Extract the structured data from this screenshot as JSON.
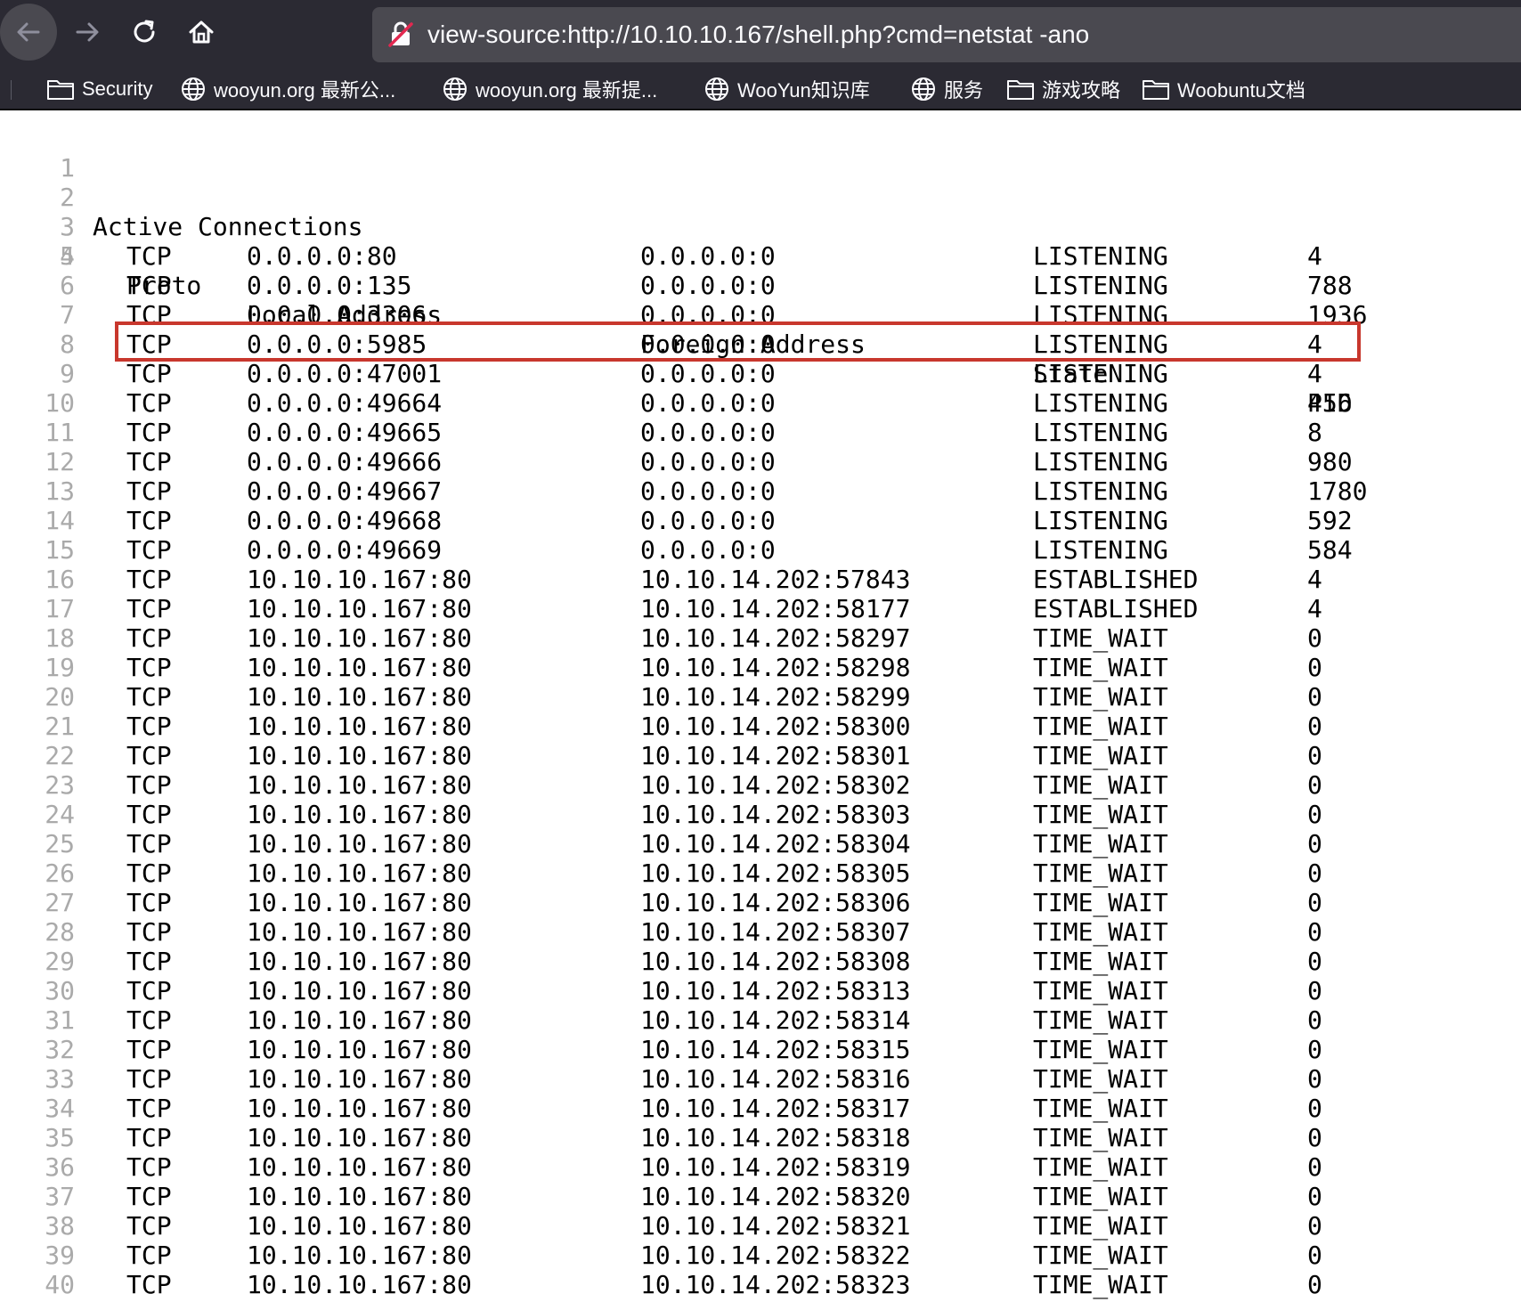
{
  "browser": {
    "url": "view-source:http://10.10.10.167/shell.php?cmd=netstat -ano",
    "colors": {
      "chrome_bg": "#2b2a33",
      "urlbar_bg": "#4a4950",
      "highlight": "#c8372d"
    },
    "bookmarks": [
      {
        "icon": "folder-icon",
        "label": "Security"
      },
      {
        "icon": "globe-icon",
        "label": "wooyun.org 最新公..."
      },
      {
        "icon": "globe-icon",
        "label": "wooyun.org 最新提..."
      },
      {
        "icon": "globe-icon",
        "label": "WooYun知识库"
      },
      {
        "icon": "globe-icon",
        "label": "服务"
      },
      {
        "icon": "folder-icon",
        "label": "游戏攻略"
      },
      {
        "icon": "folder-icon",
        "label": "Woobuntu文档"
      }
    ]
  },
  "source": {
    "title": "Active Connections",
    "headers": {
      "proto": "Proto",
      "local": "Local Address",
      "foreign": "Foreign Address",
      "state": "State",
      "pid": "PID"
    },
    "line_numbers": [
      "1",
      "2",
      "3",
      "4",
      "5",
      "6",
      "7",
      "8",
      "9",
      "10",
      "11",
      "12",
      "13",
      "14",
      "15",
      "16",
      "17",
      "18",
      "19",
      "20",
      "21",
      "22",
      "23",
      "24",
      "25",
      "26",
      "27",
      "28",
      "29",
      "30",
      "31",
      "32",
      "33",
      "34",
      "35",
      "36",
      "37",
      "38",
      "39",
      "40"
    ],
    "rows": [
      {
        "proto": "TCP",
        "local": "0.0.0.0:80",
        "foreign": "0.0.0.0:0",
        "state": "LISTENING",
        "pid": "4"
      },
      {
        "proto": "TCP",
        "local": "0.0.0.0:135",
        "foreign": "0.0.0.0:0",
        "state": "LISTENING",
        "pid": "788"
      },
      {
        "proto": "TCP",
        "local": "0.0.0.0:3306",
        "foreign": "0.0.0.0:0",
        "state": "LISTENING",
        "pid": "1936"
      },
      {
        "proto": "TCP",
        "local": "0.0.0.0:5985",
        "foreign": "0.0.0.0:0",
        "state": "LISTENING",
        "pid": "4",
        "highlighted": true
      },
      {
        "proto": "TCP",
        "local": "0.0.0.0:47001",
        "foreign": "0.0.0.0:0",
        "state": "LISTENING",
        "pid": "4"
      },
      {
        "proto": "TCP",
        "local": "0.0.0.0:49664",
        "foreign": "0.0.0.0:0",
        "state": "LISTENING",
        "pid": "456"
      },
      {
        "proto": "TCP",
        "local": "0.0.0.0:49665",
        "foreign": "0.0.0.0:0",
        "state": "LISTENING",
        "pid": "8"
      },
      {
        "proto": "TCP",
        "local": "0.0.0.0:49666",
        "foreign": "0.0.0.0:0",
        "state": "LISTENING",
        "pid": "980"
      },
      {
        "proto": "TCP",
        "local": "0.0.0.0:49667",
        "foreign": "0.0.0.0:0",
        "state": "LISTENING",
        "pid": "1780"
      },
      {
        "proto": "TCP",
        "local": "0.0.0.0:49668",
        "foreign": "0.0.0.0:0",
        "state": "LISTENING",
        "pid": "592"
      },
      {
        "proto": "TCP",
        "local": "0.0.0.0:49669",
        "foreign": "0.0.0.0:0",
        "state": "LISTENING",
        "pid": "584"
      },
      {
        "proto": "TCP",
        "local": "10.10.10.167:80",
        "foreign": "10.10.14.202:57843",
        "state": "ESTABLISHED",
        "pid": "4"
      },
      {
        "proto": "TCP",
        "local": "10.10.10.167:80",
        "foreign": "10.10.14.202:58177",
        "state": "ESTABLISHED",
        "pid": "4"
      },
      {
        "proto": "TCP",
        "local": "10.10.10.167:80",
        "foreign": "10.10.14.202:58297",
        "state": "TIME_WAIT",
        "pid": "0"
      },
      {
        "proto": "TCP",
        "local": "10.10.10.167:80",
        "foreign": "10.10.14.202:58298",
        "state": "TIME_WAIT",
        "pid": "0"
      },
      {
        "proto": "TCP",
        "local": "10.10.10.167:80",
        "foreign": "10.10.14.202:58299",
        "state": "TIME_WAIT",
        "pid": "0"
      },
      {
        "proto": "TCP",
        "local": "10.10.10.167:80",
        "foreign": "10.10.14.202:58300",
        "state": "TIME_WAIT",
        "pid": "0"
      },
      {
        "proto": "TCP",
        "local": "10.10.10.167:80",
        "foreign": "10.10.14.202:58301",
        "state": "TIME_WAIT",
        "pid": "0"
      },
      {
        "proto": "TCP",
        "local": "10.10.10.167:80",
        "foreign": "10.10.14.202:58302",
        "state": "TIME_WAIT",
        "pid": "0"
      },
      {
        "proto": "TCP",
        "local": "10.10.10.167:80",
        "foreign": "10.10.14.202:58303",
        "state": "TIME_WAIT",
        "pid": "0"
      },
      {
        "proto": "TCP",
        "local": "10.10.10.167:80",
        "foreign": "10.10.14.202:58304",
        "state": "TIME_WAIT",
        "pid": "0"
      },
      {
        "proto": "TCP",
        "local": "10.10.10.167:80",
        "foreign": "10.10.14.202:58305",
        "state": "TIME_WAIT",
        "pid": "0"
      },
      {
        "proto": "TCP",
        "local": "10.10.10.167:80",
        "foreign": "10.10.14.202:58306",
        "state": "TIME_WAIT",
        "pid": "0"
      },
      {
        "proto": "TCP",
        "local": "10.10.10.167:80",
        "foreign": "10.10.14.202:58307",
        "state": "TIME_WAIT",
        "pid": "0"
      },
      {
        "proto": "TCP",
        "local": "10.10.10.167:80",
        "foreign": "10.10.14.202:58308",
        "state": "TIME_WAIT",
        "pid": "0"
      },
      {
        "proto": "TCP",
        "local": "10.10.10.167:80",
        "foreign": "10.10.14.202:58313",
        "state": "TIME_WAIT",
        "pid": "0"
      },
      {
        "proto": "TCP",
        "local": "10.10.10.167:80",
        "foreign": "10.10.14.202:58314",
        "state": "TIME_WAIT",
        "pid": "0"
      },
      {
        "proto": "TCP",
        "local": "10.10.10.167:80",
        "foreign": "10.10.14.202:58315",
        "state": "TIME_WAIT",
        "pid": "0"
      },
      {
        "proto": "TCP",
        "local": "10.10.10.167:80",
        "foreign": "10.10.14.202:58316",
        "state": "TIME_WAIT",
        "pid": "0"
      },
      {
        "proto": "TCP",
        "local": "10.10.10.167:80",
        "foreign": "10.10.14.202:58317",
        "state": "TIME_WAIT",
        "pid": "0"
      },
      {
        "proto": "TCP",
        "local": "10.10.10.167:80",
        "foreign": "10.10.14.202:58318",
        "state": "TIME_WAIT",
        "pid": "0"
      },
      {
        "proto": "TCP",
        "local": "10.10.10.167:80",
        "foreign": "10.10.14.202:58319",
        "state": "TIME_WAIT",
        "pid": "0"
      },
      {
        "proto": "TCP",
        "local": "10.10.10.167:80",
        "foreign": "10.10.14.202:58320",
        "state": "TIME_WAIT",
        "pid": "0"
      },
      {
        "proto": "TCP",
        "local": "10.10.10.167:80",
        "foreign": "10.10.14.202:58321",
        "state": "TIME_WAIT",
        "pid": "0"
      },
      {
        "proto": "TCP",
        "local": "10.10.10.167:80",
        "foreign": "10.10.14.202:58322",
        "state": "TIME_WAIT",
        "pid": "0"
      },
      {
        "proto": "TCP",
        "local": "10.10.10.167:80",
        "foreign": "10.10.14.202:58323",
        "state": "TIME_WAIT",
        "pid": "0"
      }
    ]
  }
}
